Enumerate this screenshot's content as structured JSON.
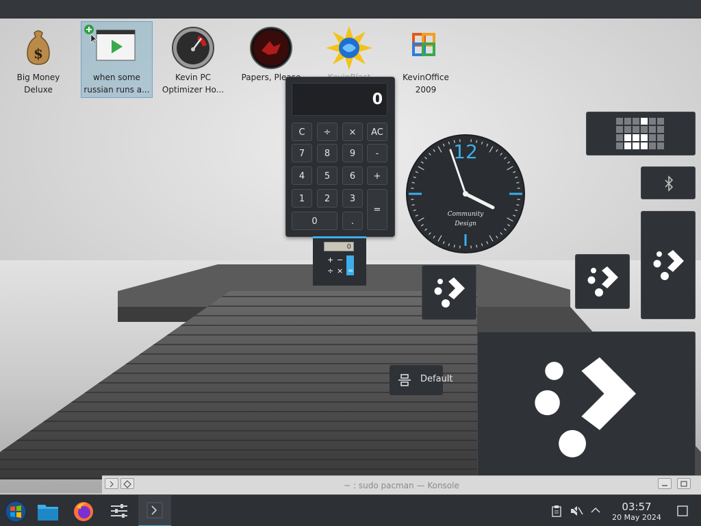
{
  "desktop_icons": [
    {
      "label": "Big Money Deluxe",
      "icon": "money-bag-icon"
    },
    {
      "label": "when some russian runs a...",
      "icon": "video-file-icon"
    },
    {
      "label": "Kevin PC Optimizer Ho...",
      "icon": "speedometer-icon"
    },
    {
      "label": "Papers, Please",
      "icon": "papers-please-icon"
    },
    {
      "label": "KevinBlast",
      "icon": "kevinblast-icon"
    },
    {
      "label": "KevinOffice 2009",
      "icon": "kevinoffice-icon"
    }
  ],
  "calculator": {
    "display": "0",
    "keys": [
      "C",
      "÷",
      "×",
      "AC",
      "7",
      "8",
      "9",
      "-",
      "4",
      "5",
      "6",
      "+",
      "1",
      "2",
      "3",
      "=",
      "0",
      "."
    ]
  },
  "mini_calculator": {
    "display": "0"
  },
  "clock": {
    "hour_label": "12",
    "brand_line1": "Community",
    "brand_line2": "Design"
  },
  "default_widget": {
    "label": "Default"
  },
  "konsole": {
    "title": "~ : sudo pacman — Konsole"
  },
  "taskbar": {
    "time": "03:57",
    "date": "20 May 2024",
    "apps": [
      "start-menu-icon",
      "file-manager-icon",
      "firefox-icon",
      "system-settings-icon",
      "konsole-icon"
    ]
  },
  "colors": {
    "accent": "#3daee9",
    "panel": "#2d3035",
    "widget": "#2f3237"
  }
}
